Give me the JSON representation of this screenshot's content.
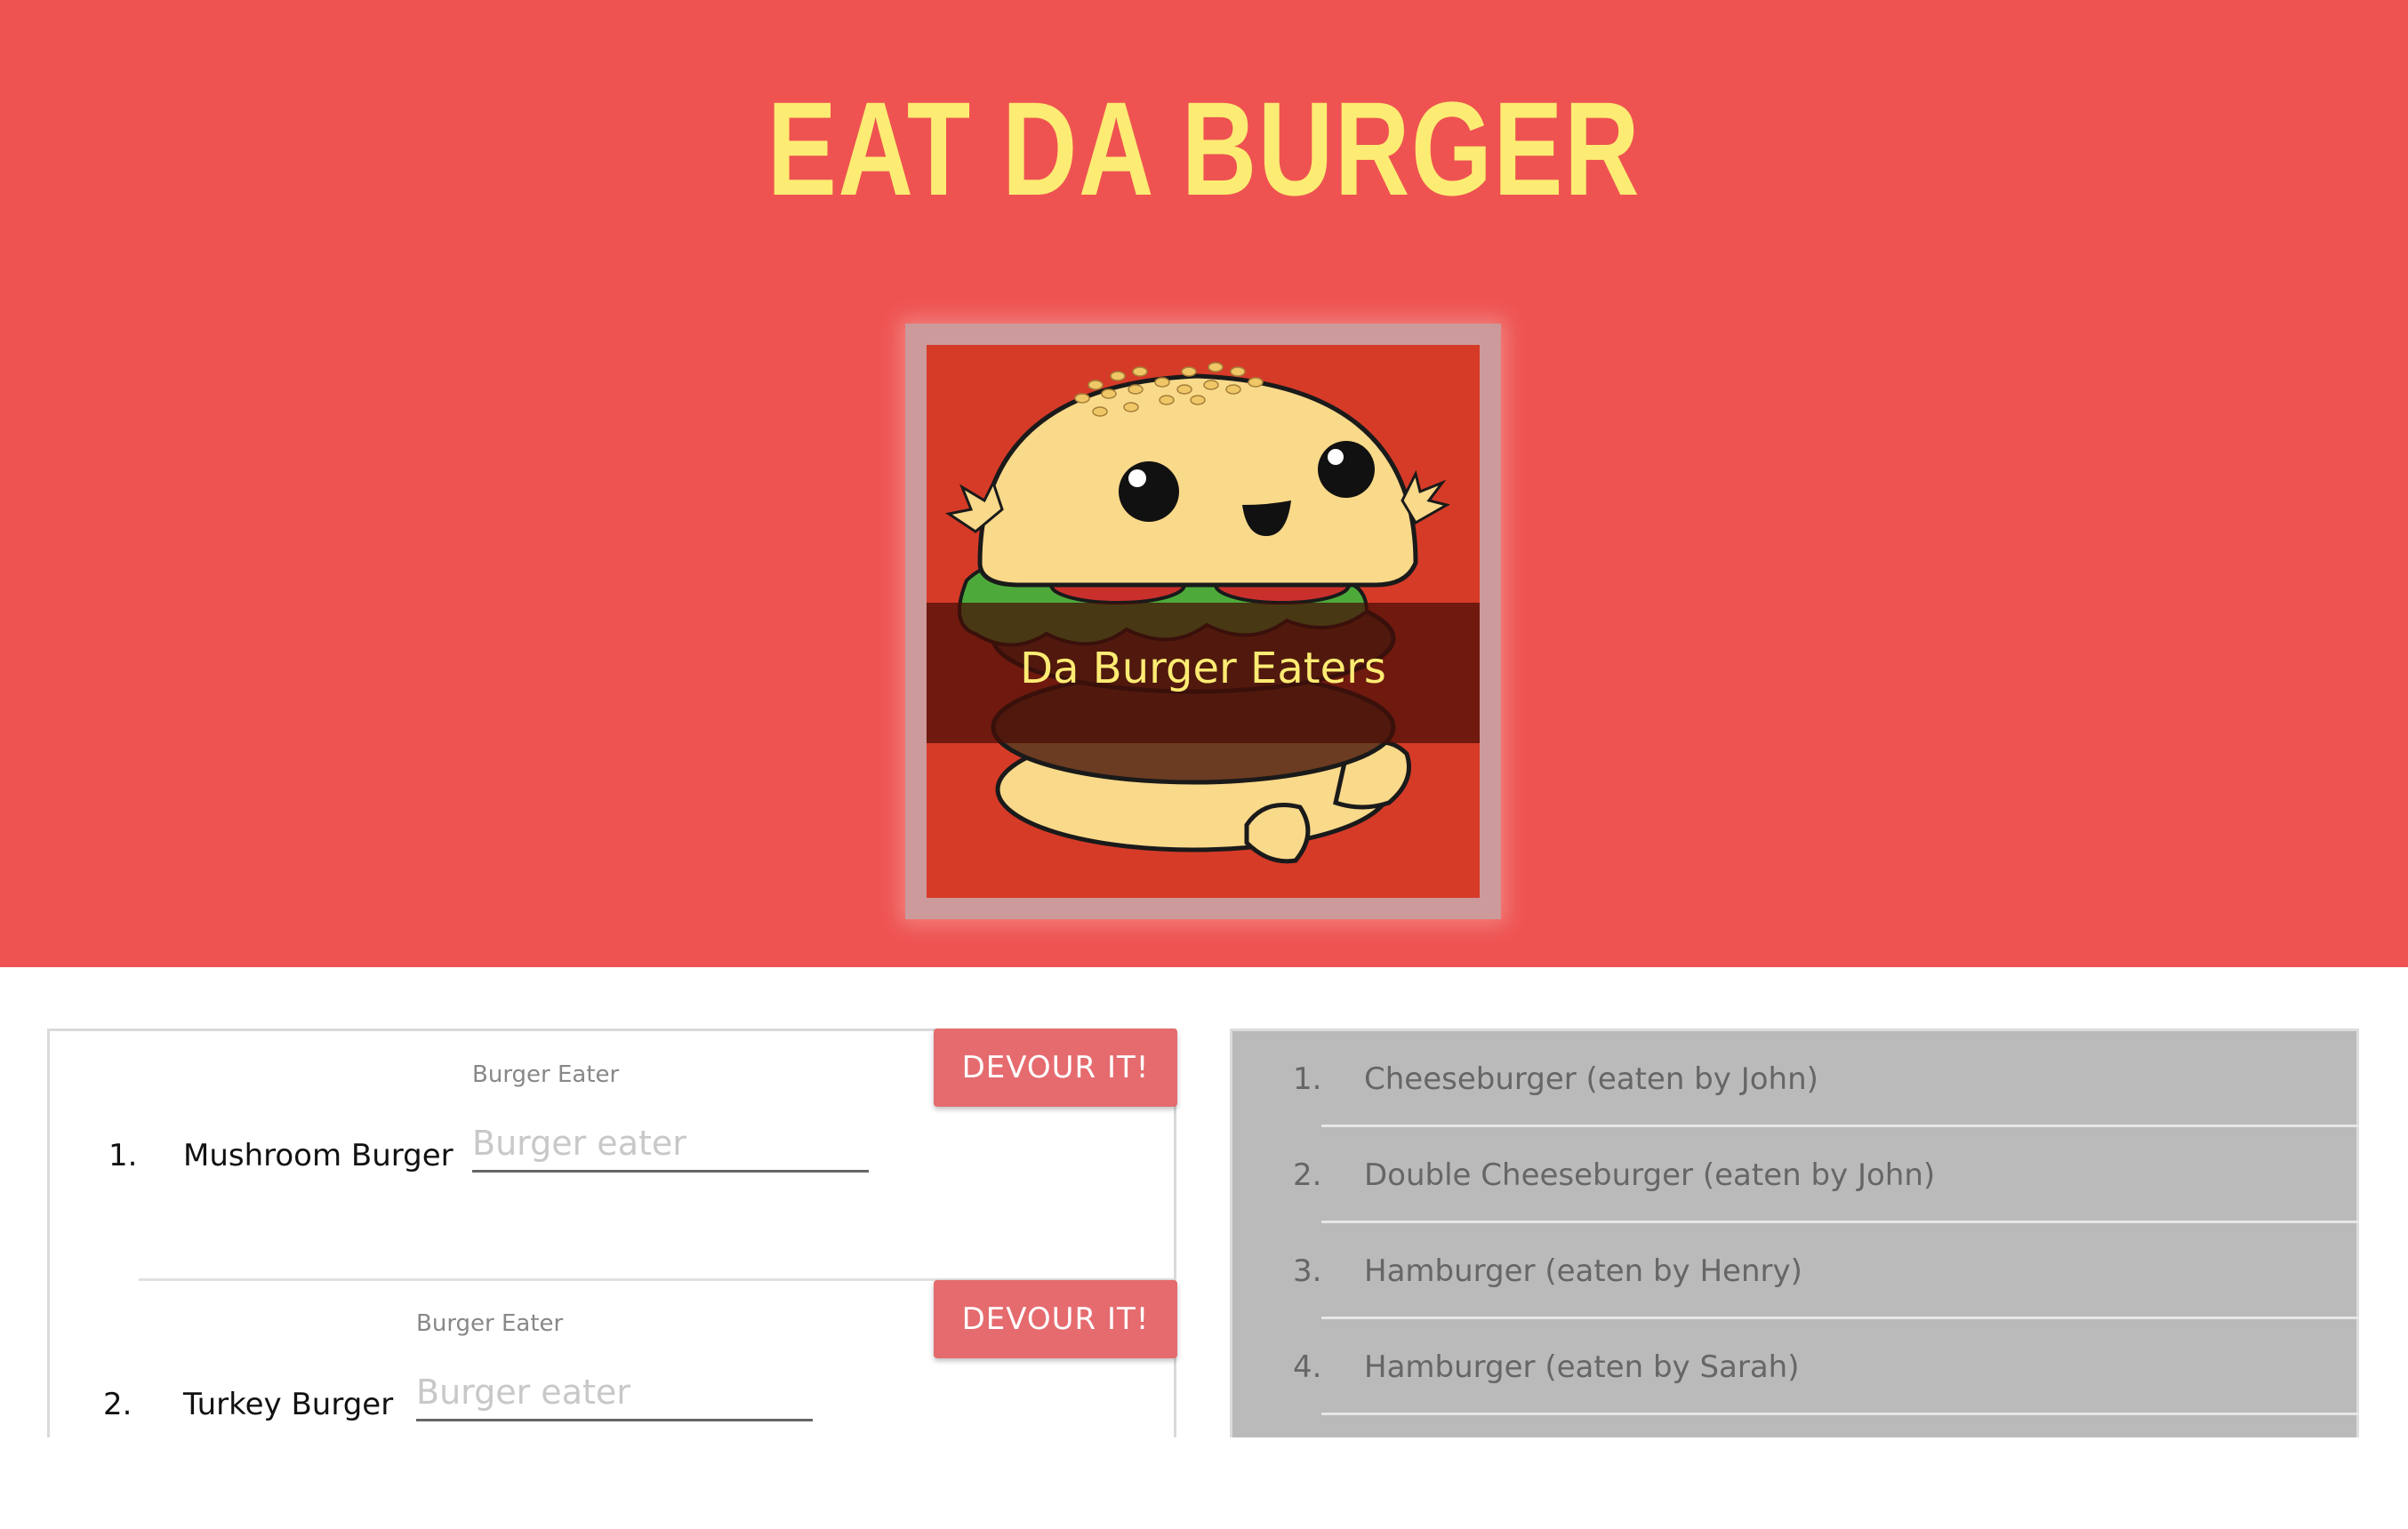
{
  "header": {
    "title": "EAT DA BURGER",
    "logo_caption": "Da Burger Eaters"
  },
  "colors": {
    "hero_background": "#ee5351",
    "title_color": "#fdec73",
    "devour_button": "#e56b6f",
    "eaten_panel": "#bababa"
  },
  "burgers_to_eat": [
    {
      "number": "1.",
      "name": "Mushroom Burger",
      "field_label": "Burger Eater",
      "placeholder": "Burger eater",
      "button_label": "DEVOUR IT!"
    },
    {
      "number": "2.",
      "name": "Turkey Burger",
      "field_label": "Burger Eater",
      "placeholder": "Burger eater",
      "button_label": "DEVOUR IT!"
    }
  ],
  "devoured_burgers": [
    {
      "number": "1.",
      "text": "Cheeseburger (eaten by John)"
    },
    {
      "number": "2.",
      "text": "Double Cheeseburger (eaten by John)"
    },
    {
      "number": "3.",
      "text": "Hamburger (eaten by Henry)"
    },
    {
      "number": "4.",
      "text": "Hamburger (eaten by Sarah)"
    }
  ]
}
